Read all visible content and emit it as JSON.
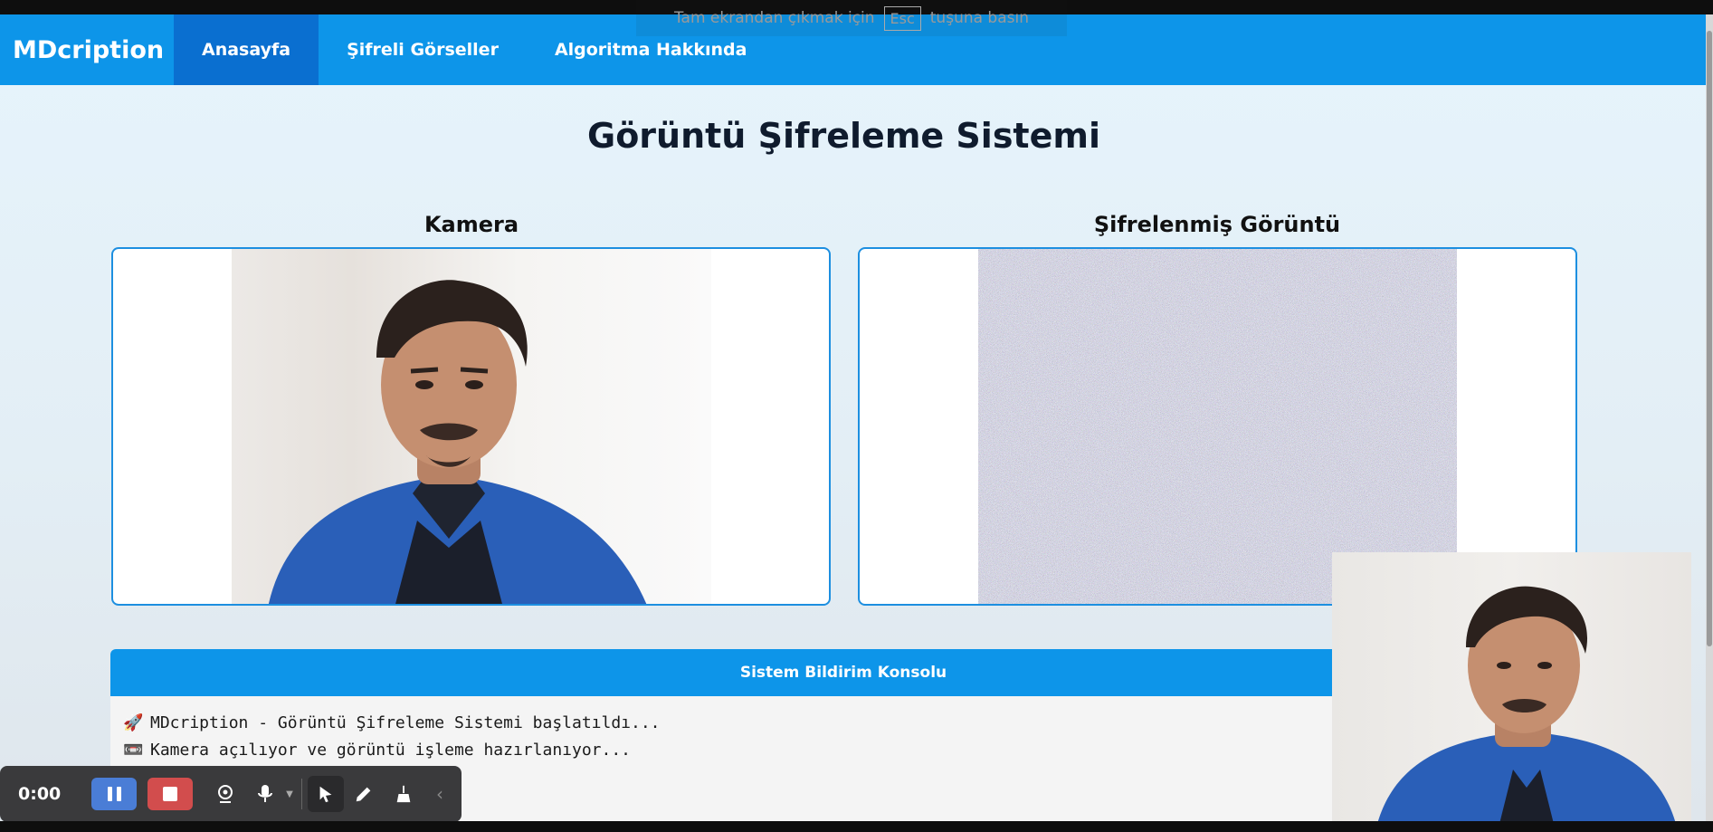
{
  "navbar": {
    "brand": "MDcription",
    "items": [
      {
        "label": "Anasayfa",
        "active": true
      },
      {
        "label": "Şifreli Görseller",
        "active": false
      },
      {
        "label": "Algoritma Hakkında",
        "active": false
      }
    ]
  },
  "page": {
    "title": "Görüntü Şifreleme Sistemi"
  },
  "panels": {
    "camera_title": "Kamera",
    "encrypted_title": "Şifrelenmiş Görüntü"
  },
  "console": {
    "title": "Sistem Bildirim Konsolu",
    "lines": [
      {
        "icon": "rocket-icon",
        "glyph": "🚀",
        "text": "MDcription - Görüntü Şifreleme Sistemi başlatıldı..."
      },
      {
        "icon": "camera-icon",
        "glyph": "📼",
        "text": "Kamera açılıyor ve görüntü işleme hazırlanıyor..."
      }
    ]
  },
  "fullscreen_banner": {
    "before": "Tam ekrandan çıkmak için",
    "key": "Esc",
    "after": "tuşuna basın"
  },
  "recorder": {
    "time": "0:00"
  },
  "colors": {
    "nav": "#0d95e9",
    "nav_active": "#0a6fd0",
    "panel_border": "#1d8fe0",
    "record_stop": "#d24d4d",
    "record_pause": "#4a7dd6"
  }
}
